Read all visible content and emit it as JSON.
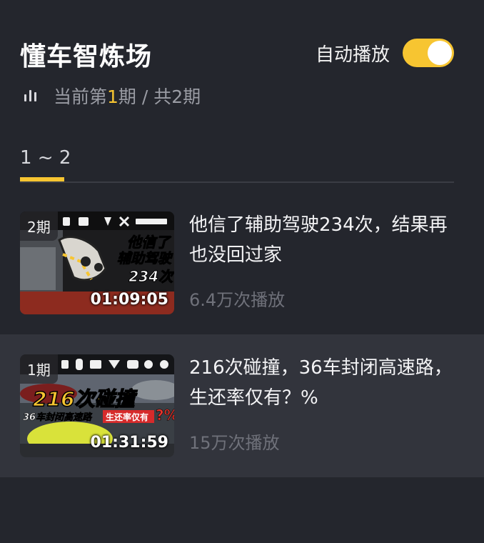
{
  "header": {
    "title": "懂车智炼场",
    "autoplay_label": "自动播放",
    "autoplay_on": true
  },
  "progress": {
    "prefix": "当前第",
    "current": "1",
    "suffix": "期 / 共2期",
    "icon": "signal-bars-icon"
  },
  "tabs": [
    {
      "label": "1 ~ 2",
      "active": true
    }
  ],
  "episodes": [
    {
      "badge": "2期",
      "duration": "01:09:05",
      "title": "他信了辅助驾驶234次，结果再也没回过家",
      "views": "6.4万次播放",
      "thumb_text": [
        "他信了",
        "辅助驾驶",
        "234次"
      ],
      "active": false
    },
    {
      "badge": "1期",
      "duration": "01:31:59",
      "title": "216次碰撞，36车封闭高速路，生还率仅有？%",
      "views": "15万次播放",
      "thumb_text": [
        "216次碰撞",
        "36车封闭高速路",
        "生还率仅有",
        "?%"
      ],
      "active": true
    }
  ],
  "colors": {
    "background": "#24262d",
    "accent": "#f7c531",
    "active_row": "#32343c",
    "muted_text": "#6f717a"
  }
}
